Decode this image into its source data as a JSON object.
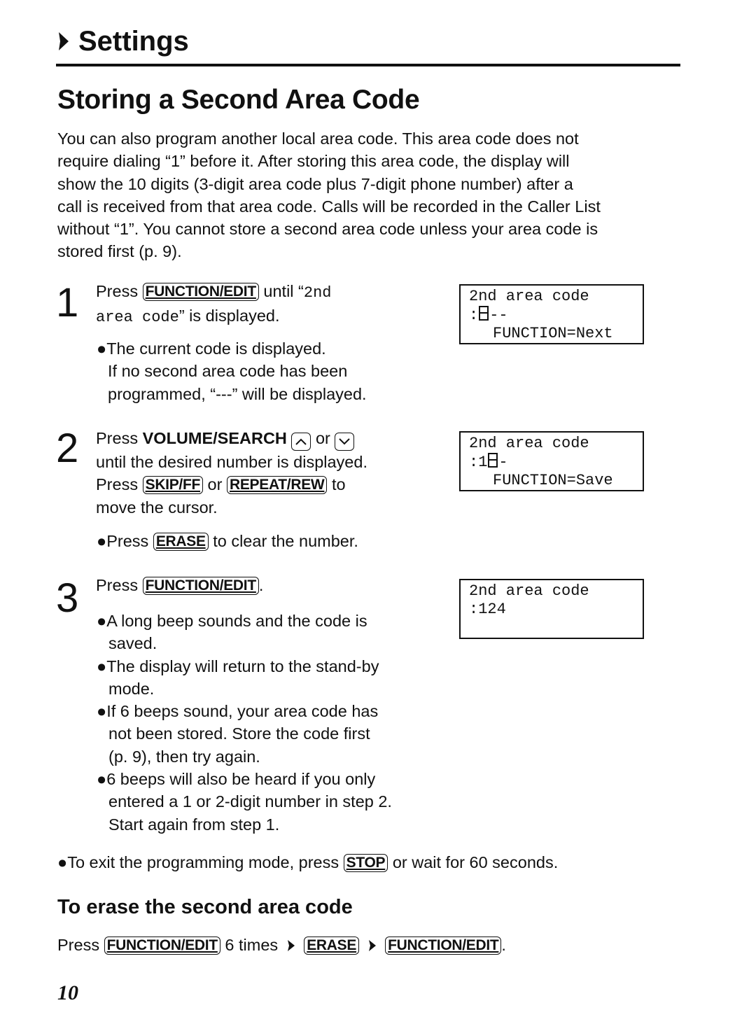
{
  "section": {
    "title": "Settings",
    "icon": "arrow-right-icon"
  },
  "page_title": "Storing a Second Area Code",
  "intro": [
    "You can also program another local area code. This area code does not",
    "require dialing “1” before it. After storing this area code, the display will",
    "show the 10 digits (3-digit area code plus 7-digit phone number) after a",
    "call is received from that area code. Calls will be recorded in the Caller List",
    "without “1”. You cannot store a second area code unless your area code is",
    "stored first (p. 9)."
  ],
  "steps": [
    {
      "number": "1",
      "press": "Press",
      "key": "FUNCTION/EDIT",
      "after_key": "until “",
      "mono1": "2nd",
      "mono2": "area code",
      "after_mono": "” is displayed.",
      "bullet": "The current code is displayed.",
      "bullet_line2": "If no second area code has been",
      "bullet_line3": "programmed, “---” will be displayed.",
      "display": {
        "line1": "2nd area code",
        "line2_prefix": ":",
        "line2_suffix": "--",
        "line3": "FUNCTION=Next"
      }
    },
    {
      "number": "2",
      "press": "Press",
      "bold_label": "VOLUME/SEARCH",
      "or": "or",
      "line2": "until the desired number is displayed.",
      "press2": "Press",
      "key1": "SKIP/FF",
      "or2": "or",
      "key2": "REPEAT/REW",
      "to": "to",
      "line4": "move the cursor.",
      "bullet_press": "Press",
      "bullet_key": "ERASE",
      "bullet_after": "to clear the number.",
      "display": {
        "line1": "2nd area code",
        "line2_prefix": ":1",
        "line2_suffix": "-",
        "line3": "FUNCTION=Save"
      }
    },
    {
      "number": "3",
      "press": "Press",
      "key": "FUNCTION/EDIT",
      "period": ".",
      "bullets": [
        [
          "A long beep sounds and the code is",
          "saved."
        ],
        [
          "The display will return to the stand-by",
          "mode."
        ],
        [
          "If 6 beeps sound, your area code has",
          "not been stored. Store the code first",
          "(p. 9), then try again."
        ],
        [
          "6 beeps will also be heard if you only",
          "entered a 1 or 2-digit number in step 2.",
          "Start again from step 1."
        ]
      ],
      "display": {
        "line1": "2nd area code",
        "line2": ":124"
      }
    }
  ],
  "exit_note": {
    "before": "To exit the programming mode, press",
    "key": "STOP",
    "after": "or wait for 60 seconds."
  },
  "erase_section": {
    "heading": "To erase the second area code",
    "press": "Press",
    "key1": "FUNCTION/EDIT",
    "times": "6 times",
    "key2": "ERASE",
    "key3": "FUNCTION/EDIT",
    "period": "."
  },
  "page_number": "10"
}
